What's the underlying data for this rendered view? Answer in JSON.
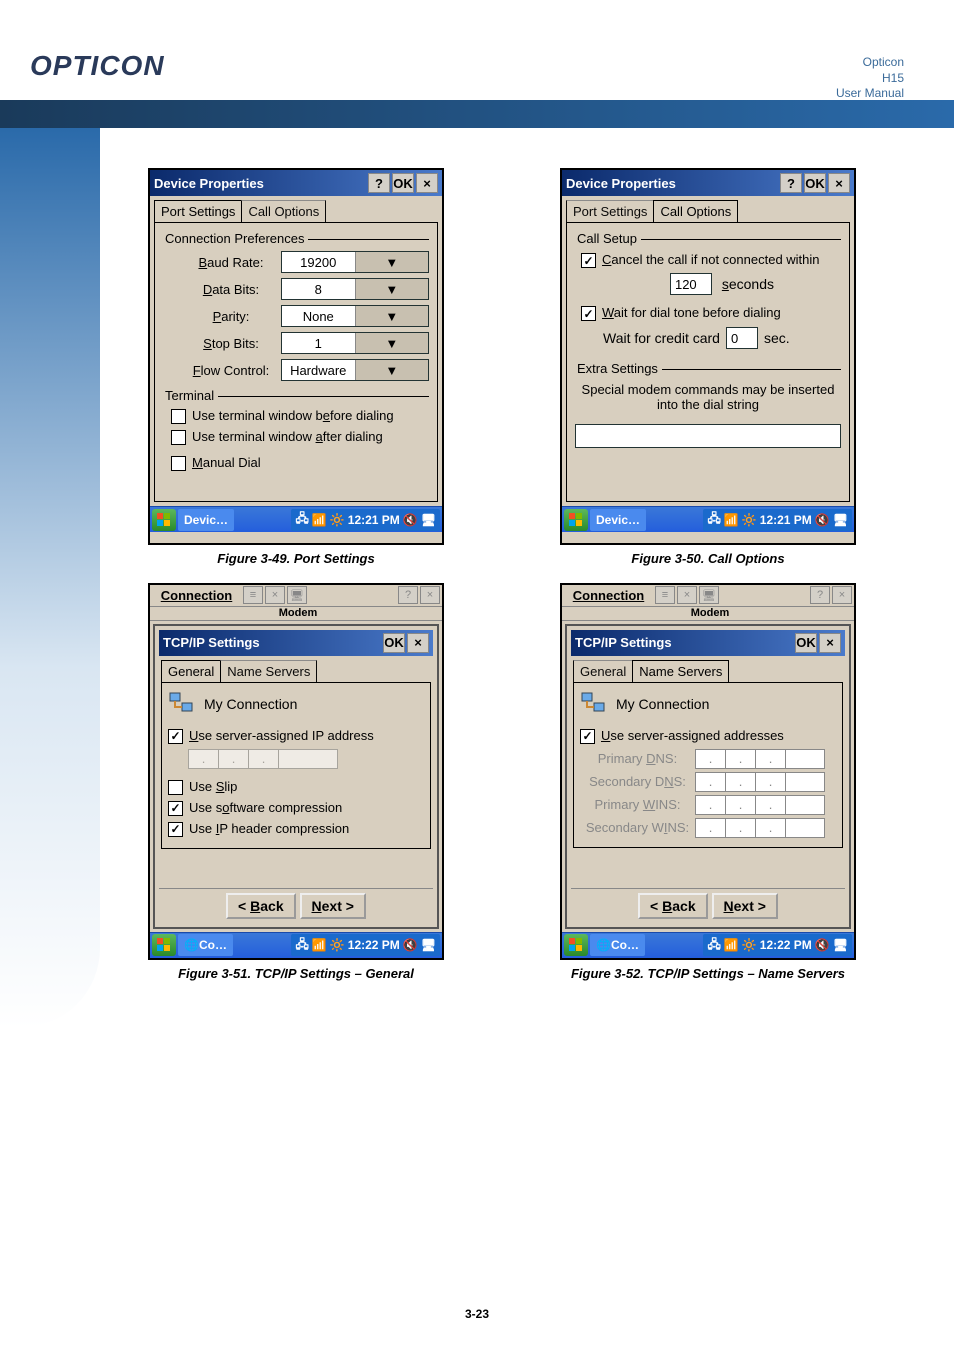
{
  "header": {
    "brand": "OPTICON",
    "line1": "Opticon",
    "line2": "H15",
    "line3": "User Manual"
  },
  "fig49": {
    "title": "Device Properties",
    "tab1": "Port Settings",
    "tab2": "Call Options",
    "group": "Connection Preferences",
    "baud_l": "Baud Rate:",
    "baud_v": "19200",
    "data_l": "Data Bits:",
    "data_v": "8",
    "par_l": "Parity:",
    "par_v": "None",
    "stop_l": "Stop Bits:",
    "stop_v": "1",
    "flow_l": "Flow Control:",
    "flow_v": "Hardware",
    "term_g": "Terminal",
    "chk_before": "Use terminal window before dialing",
    "chk_after": "Use terminal window after dialing",
    "chk_manual": "Manual Dial",
    "task": "Devic…",
    "time": "12:21 PM",
    "caption": "Figure 3-49. Port Settings"
  },
  "fig50": {
    "title": "Device Properties",
    "tab1": "Port Settings",
    "tab2": "Call Options",
    "group": "Call Setup",
    "chk_cancel": "Cancel the call if not connected within",
    "sec_v": "120",
    "sec_l": "seconds",
    "chk_wait": "Wait for dial tone before dialing",
    "credit_l": "Wait for credit card",
    "credit_v": "0",
    "credit_u": "sec.",
    "extra_g": "Extra Settings",
    "extra_txt": "Special modem commands may be inserted into the dial string",
    "task": "Devic…",
    "time": "12:21 PM",
    "caption": "Figure 3-50. Call Options"
  },
  "fig51": {
    "behind": "Connection",
    "behind2": "Modem",
    "title": "TCP/IP Settings",
    "tab1": "General",
    "tab2": "Name Servers",
    "conn": "My Connection",
    "chk_ip": "Use server-assigned IP address",
    "chk_slip": "Use Slip",
    "chk_soft": "Use software compression",
    "chk_iph": "Use IP header compression",
    "back": "< Back",
    "next": "Next >",
    "task": "Co…",
    "time": "12:22 PM",
    "caption": "Figure 3-51. TCP/IP Settings – General"
  },
  "fig52": {
    "behind": "Connection",
    "behind2": "Modem",
    "title": "TCP/IP Settings",
    "tab1": "General",
    "tab2": "Name Servers",
    "conn": "My Connection",
    "chk_addr": "Use server-assigned addresses",
    "pdns": "Primary DNS:",
    "sdns": "Secondary DNS:",
    "pwins": "Primary WINS:",
    "swins": "Secondary WINS:",
    "back": "< Back",
    "next": "Next >",
    "task": "Co…",
    "time": "12:22 PM",
    "caption": "Figure 3-52. TCP/IP Settings – Name Servers"
  },
  "footer": {
    "pagenum": "3-23"
  }
}
